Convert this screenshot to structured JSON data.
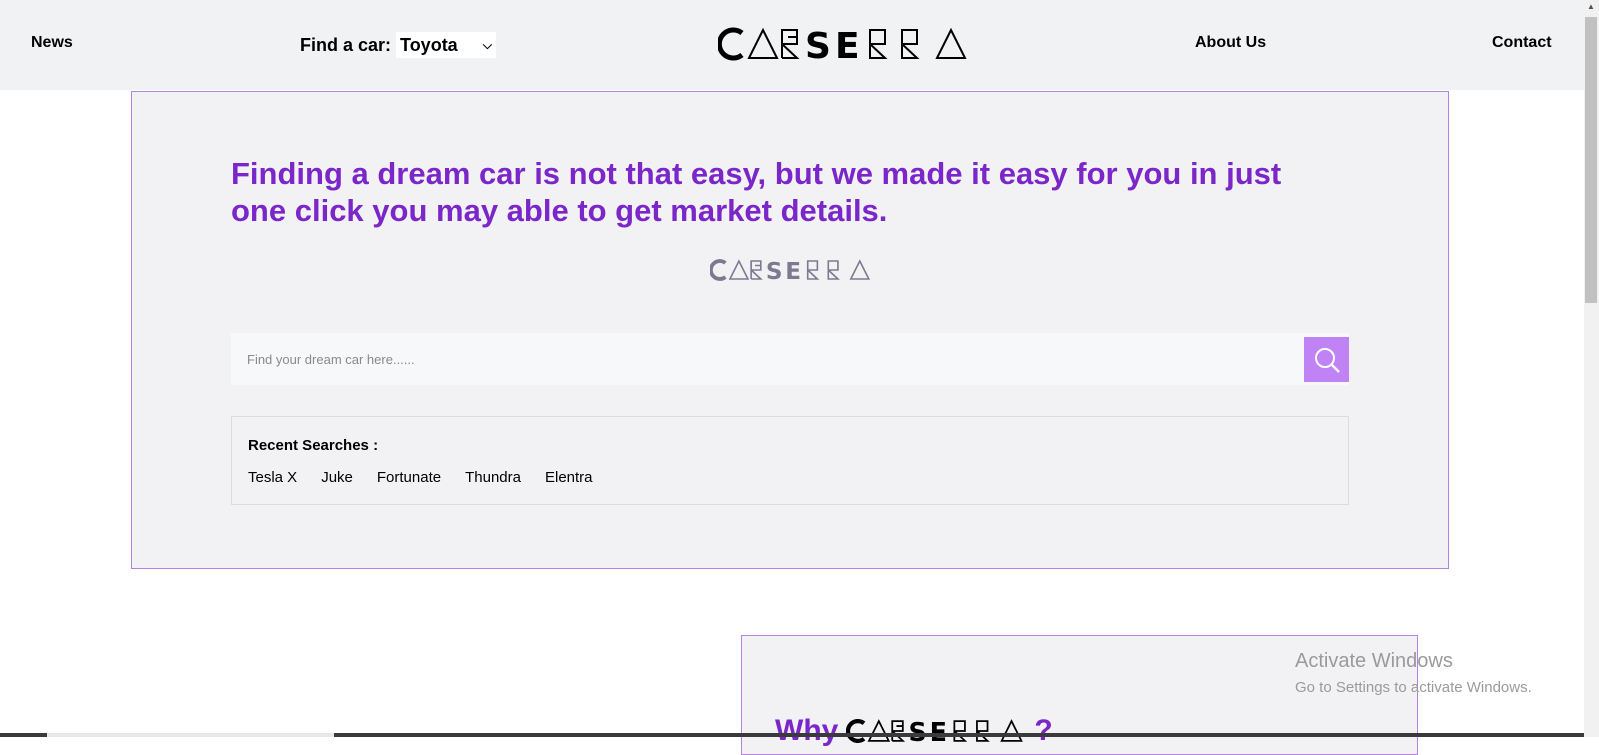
{
  "nav": {
    "news": "News",
    "find_label": "Find a car:",
    "find_selected": "Toyota",
    "about": "About Us",
    "contact": "Contact",
    "logo_text": "CARSERRA"
  },
  "hero": {
    "title": "Finding a dream car is not that easy, but we made it easy for you in just one click you may able to get market details.",
    "logo_text": "CARSERRA",
    "search_placeholder": "Find your dream car here......",
    "recent_title": "Recent Searches :",
    "recent_items": [
      "Tesla X",
      "Juke",
      "Fortunate",
      "Thundra",
      "Elentra"
    ]
  },
  "why": {
    "prefix": "Why",
    "logo_text": "CARSERRA",
    "suffix": "?"
  },
  "watermark": {
    "line1": "Activate Windows",
    "line2": "Go to Settings to activate Windows."
  },
  "colors": {
    "accent": "#7a26c9",
    "search_button": "#c083f5",
    "border": "#b584e0"
  },
  "icons": [
    "search-icon",
    "chevron-down-icon",
    "scroll-up-arrow-icon"
  ]
}
